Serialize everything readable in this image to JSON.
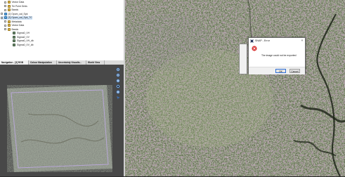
{
  "tree": {
    "items": [
      {
        "label": "Vector Data",
        "icon": "folder-icon"
      },
      {
        "label": "Tie Point Grids",
        "icon": "folder-icon"
      },
      {
        "label": "Bands",
        "icon": "folder-icon"
      },
      {
        "label": "[2] Opum_cal_Spk",
        "icon": "product-icon"
      },
      {
        "label": "[3] Opum_cal_Spk_TC",
        "icon": "product-icon"
      },
      {
        "label": "Metadata",
        "icon": "folder-icon"
      },
      {
        "label": "Vector Data",
        "icon": "folder-icon"
      },
      {
        "label": "Bands",
        "icon": "folder-icon"
      },
      {
        "label": "Sigma0_VH",
        "icon": "band-icon"
      },
      {
        "label": "Sigma0_VV",
        "icon": "band-icon"
      },
      {
        "label": "Sigma0_VH_db",
        "icon": "band-icon"
      },
      {
        "label": "Sigma0_VV_db",
        "icon": "band-icon"
      }
    ]
  },
  "nav_tabs": [
    "Navigation - [3] RGB",
    "Colour Manipulation",
    "Uncertainty Visualis...",
    "World View"
  ],
  "dialog": {
    "title": "SNAP - Error",
    "message": "The image could not be exported",
    "ok_label": "OK",
    "cancel_label": "Cancel",
    "close_glyph": "×"
  },
  "colors": {
    "error": "#d93a3a",
    "accent": "#2f6fd6",
    "nav_panel_bg": "#484848"
  }
}
